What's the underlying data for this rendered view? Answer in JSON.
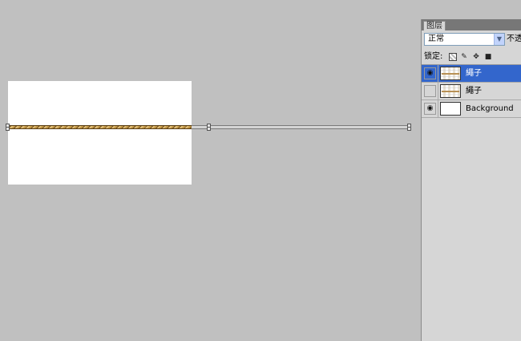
{
  "panel": {
    "tab_label": "图层",
    "blend_mode": "正常",
    "opacity_label": "不透",
    "lock_label": "锁定:"
  },
  "layers": [
    {
      "name": "繩子",
      "visible": true,
      "selected": true,
      "thumbnail": "rope-thumbnail"
    },
    {
      "name": "繩子",
      "visible": false,
      "selected": false,
      "thumbnail": "rope-thumbnail"
    },
    {
      "name": "Background",
      "visible": true,
      "selected": false,
      "thumbnail": "white-thumbnail"
    }
  ],
  "colors": {
    "workspace": "#c0c0c0",
    "selected_layer": "#3366cc",
    "rope": "#c59a48"
  }
}
